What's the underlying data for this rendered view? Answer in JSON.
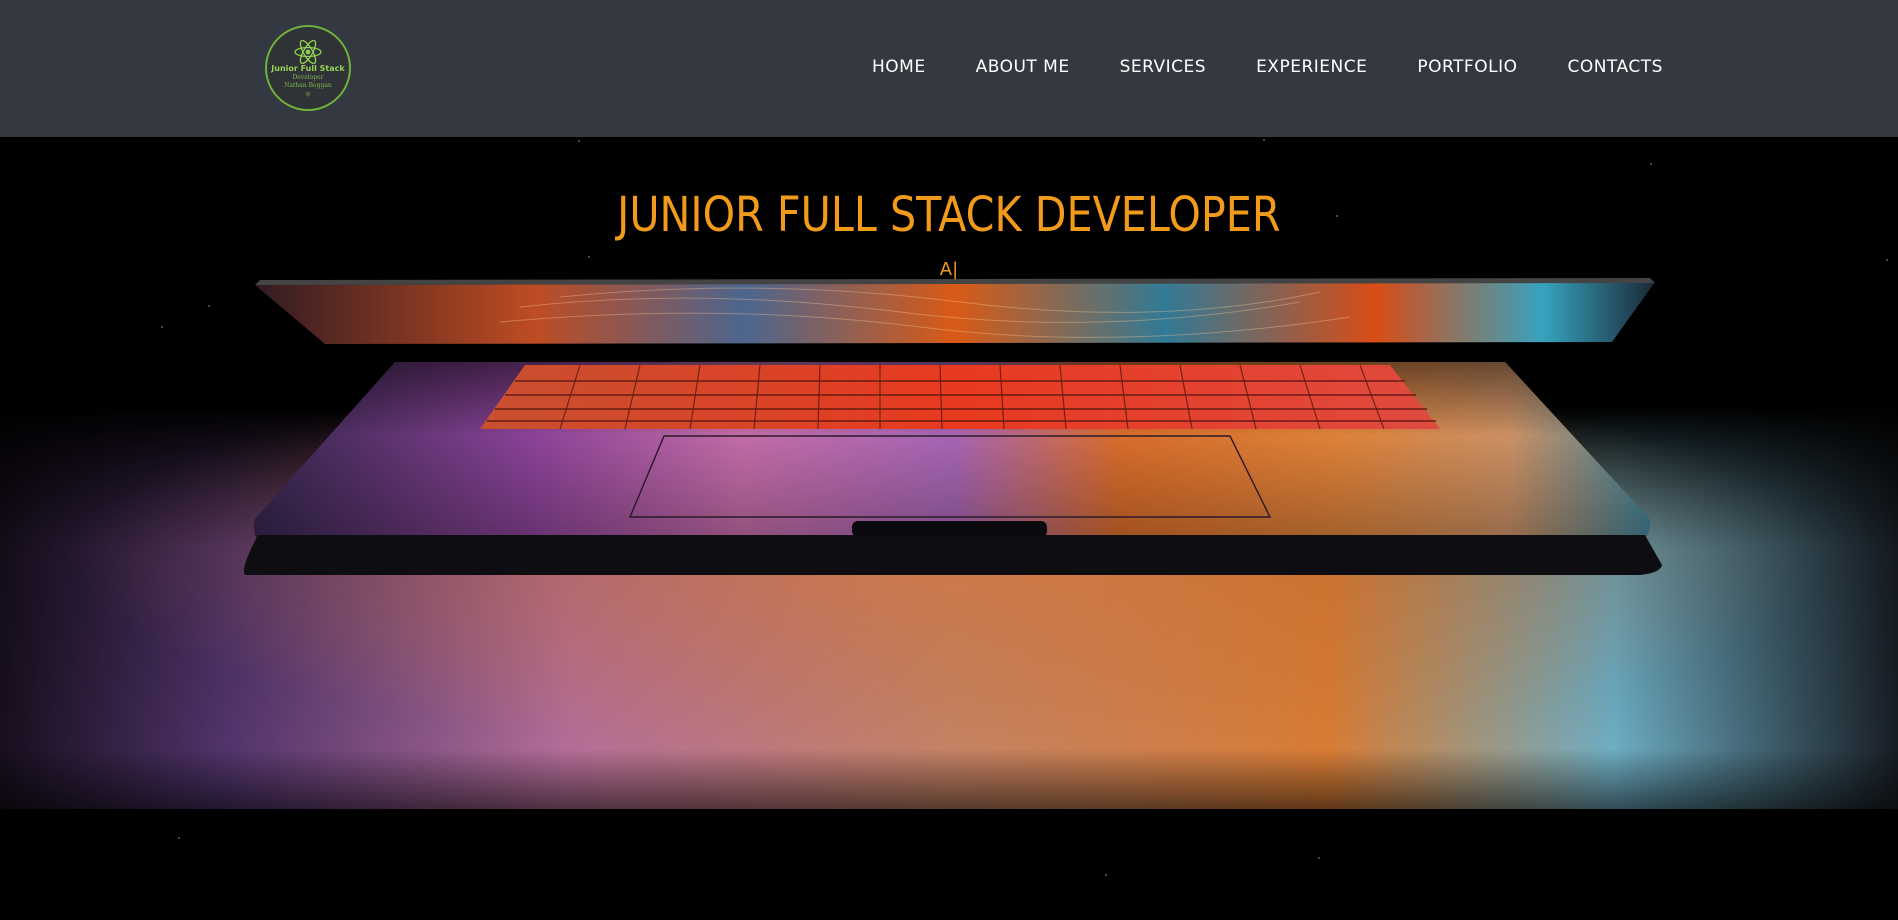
{
  "navbar": {
    "logo": {
      "title": "Junior Full Stack",
      "subtitle": "Developer",
      "name": "Nathan Boggan",
      "icon": "atom-icon"
    },
    "items": [
      {
        "label": "HOME"
      },
      {
        "label": "ABOUT ME"
      },
      {
        "label": "SERVICES"
      },
      {
        "label": "EXPERIENCE"
      },
      {
        "label": "PORTFOLIO"
      },
      {
        "label": "CONTACTS"
      }
    ]
  },
  "hero": {
    "title": "JUNIOR FULL STACK DEVELOPER",
    "typed_text": "A|",
    "image": "laptop-glowing-image"
  },
  "colors": {
    "navbar_bg": "#343840",
    "accent": "#f29a1c",
    "logo_green": "#6fb13b",
    "hero_bg": "#000000"
  }
}
